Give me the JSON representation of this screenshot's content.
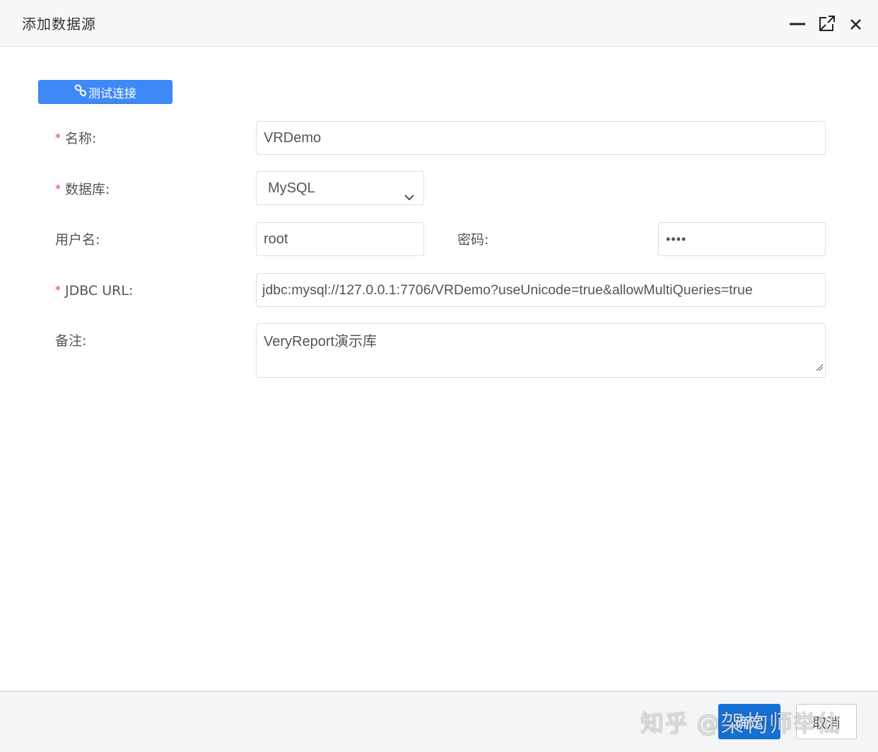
{
  "dialog": {
    "title": "添加数据源"
  },
  "toolbar": {
    "test_connection_label": "测试连接"
  },
  "form": {
    "name": {
      "label": "名称:",
      "required": true,
      "value": "VRDemo"
    },
    "database": {
      "label": "数据库:",
      "required": true,
      "value": "MySQL"
    },
    "username": {
      "label": "用户名:",
      "required": false,
      "value": "root"
    },
    "password": {
      "label": "密码:",
      "required": false,
      "value": "••••"
    },
    "jdbc_url": {
      "label": "JDBC URL:",
      "required": true,
      "value": "jdbc:mysql://127.0.0.1:7706/VRDemo?useUnicode=true&allowMultiQueries=true"
    },
    "remark": {
      "label": "备注:",
      "required": false,
      "value": "VeryReport演示库"
    }
  },
  "footer": {
    "ok_label": "确定",
    "cancel_label": "取消",
    "watermark": "知乎 @架构师举仙"
  },
  "colors": {
    "primary": "#3d8af7",
    "ok_button": "#1470d6",
    "required_mark": "#e4393c"
  },
  "icons": [
    "minimize-icon",
    "maximize-icon",
    "close-icon",
    "link-icon",
    "chevron-down-icon"
  ]
}
